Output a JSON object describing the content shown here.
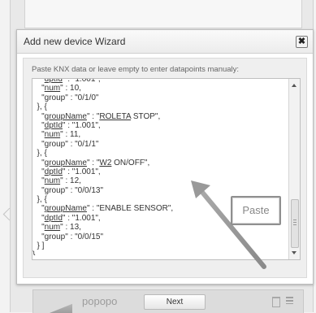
{
  "background": {
    "device_label": "popopo"
  },
  "dialog": {
    "title": "Add new device Wizard",
    "close_label": "✖",
    "instruction": "Paste KNX data or leave empty to enter datapoints manualy:",
    "code_lines": [
      [
        {
          "t": "    \""
        },
        {
          "t": "dptId",
          "u": true
        },
        {
          "t": "\" : \"1.001\","
        }
      ],
      [
        {
          "t": "    \""
        },
        {
          "t": "num",
          "u": true
        },
        {
          "t": "\" : 10,"
        }
      ],
      [
        {
          "t": "    \"group\" : \"0/1/0\""
        }
      ],
      [
        {
          "t": "  }, {"
        }
      ],
      [
        {
          "t": "    \""
        },
        {
          "t": "groupName",
          "u": true
        },
        {
          "t": "\" : \""
        },
        {
          "t": "ROLETA",
          "u": true
        },
        {
          "t": " STOP\","
        }
      ],
      [
        {
          "t": "    \""
        },
        {
          "t": "dptId",
          "u": true
        },
        {
          "t": "\" : \"1.001\","
        }
      ],
      [
        {
          "t": "    \""
        },
        {
          "t": "num",
          "u": true
        },
        {
          "t": "\" : 11,"
        }
      ],
      [
        {
          "t": "    \"group\" : \"0/1/1\""
        }
      ],
      [
        {
          "t": "  }, {"
        }
      ],
      [
        {
          "t": "    \""
        },
        {
          "t": "groupName",
          "u": true
        },
        {
          "t": "\" : \""
        },
        {
          "t": "W2",
          "u": true
        },
        {
          "t": " ON/OFF\","
        }
      ],
      [
        {
          "t": "    \""
        },
        {
          "t": "dptId",
          "u": true
        },
        {
          "t": "\" : \"1.001\","
        }
      ],
      [
        {
          "t": "    \""
        },
        {
          "t": "num",
          "u": true
        },
        {
          "t": "\" : 12,"
        }
      ],
      [
        {
          "t": "    \"group\" : \"0/0/13\""
        }
      ],
      [
        {
          "t": "  }, {"
        }
      ],
      [
        {
          "t": "    \""
        },
        {
          "t": "groupName",
          "u": true
        },
        {
          "t": "\" : \"ENABLE SENSOR\","
        }
      ],
      [
        {
          "t": "    \""
        },
        {
          "t": "dptId",
          "u": true
        },
        {
          "t": "\" : \"1.001\","
        }
      ],
      [
        {
          "t": "    \""
        },
        {
          "t": "num",
          "u": true
        },
        {
          "t": "\" : 13,"
        }
      ],
      [
        {
          "t": "    \"group\" : \"0/0/15\""
        }
      ],
      [
        {
          "t": "  } ]"
        }
      ],
      [
        {
          "t": "}"
        }
      ]
    ],
    "next_label": "Next"
  },
  "annotation": {
    "callout_label": "Paste"
  },
  "colors": {
    "dialog_bg": "#ffffff",
    "body_bg": "#efefef",
    "annotation_gray": "#8f8f8f"
  }
}
